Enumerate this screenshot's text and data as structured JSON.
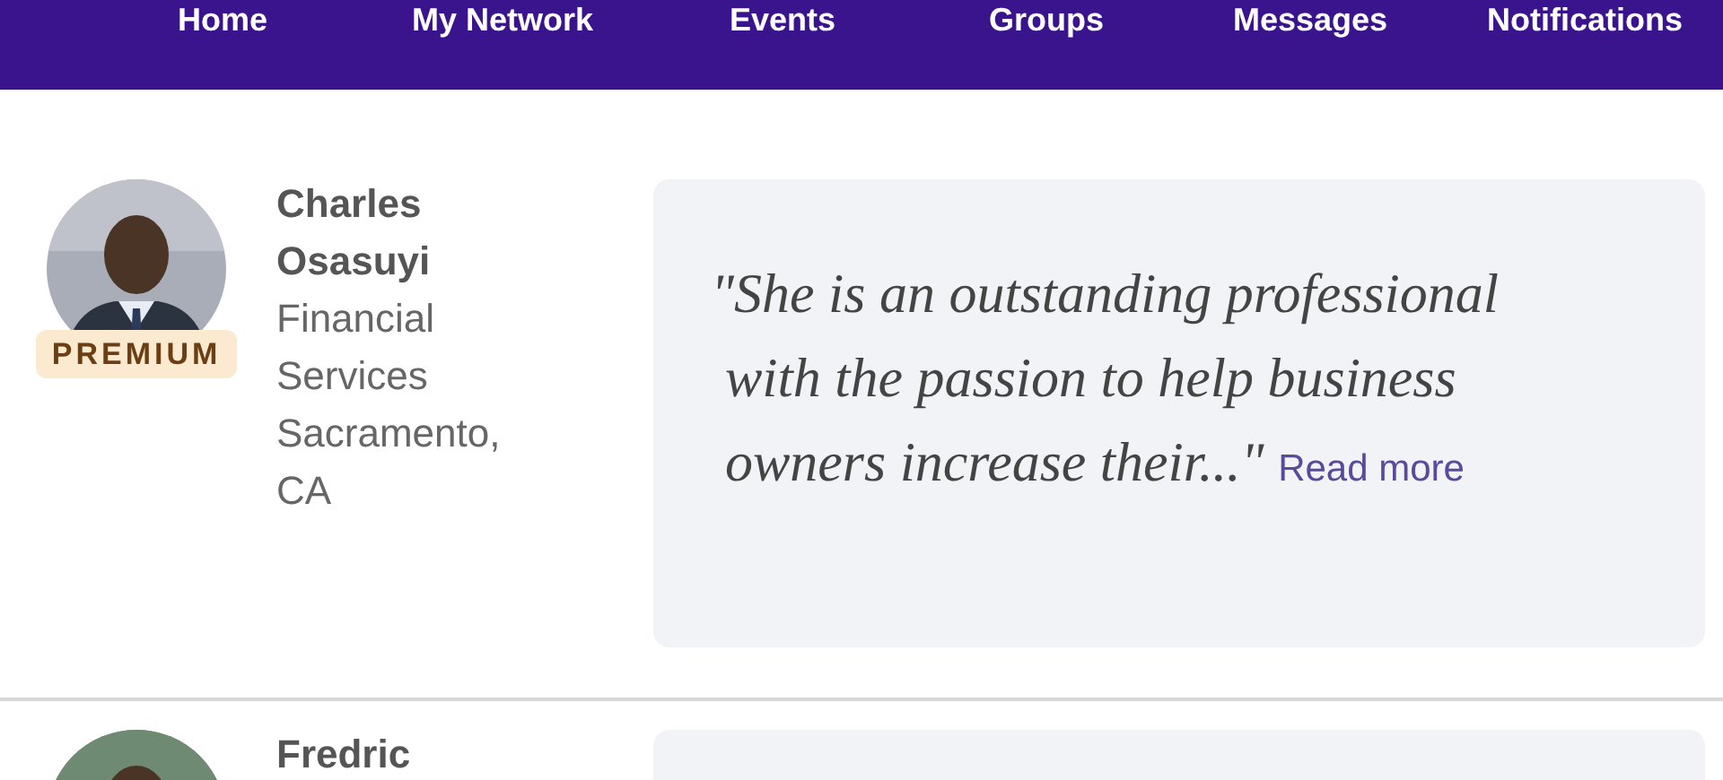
{
  "nav": {
    "items": [
      "Home",
      "My Network",
      "Events",
      "Groups",
      "Messages",
      "Notifications"
    ]
  },
  "members": [
    {
      "name": "Charles Osasuyi",
      "industry": "Financial Services",
      "location": "Sacramento, CA",
      "badge": "PREMIUM",
      "quote": "\"She is an outstanding professional with the passion to help business owners increase their...\"",
      "link": "Read more"
    },
    {
      "name": "Fredric"
    }
  ]
}
